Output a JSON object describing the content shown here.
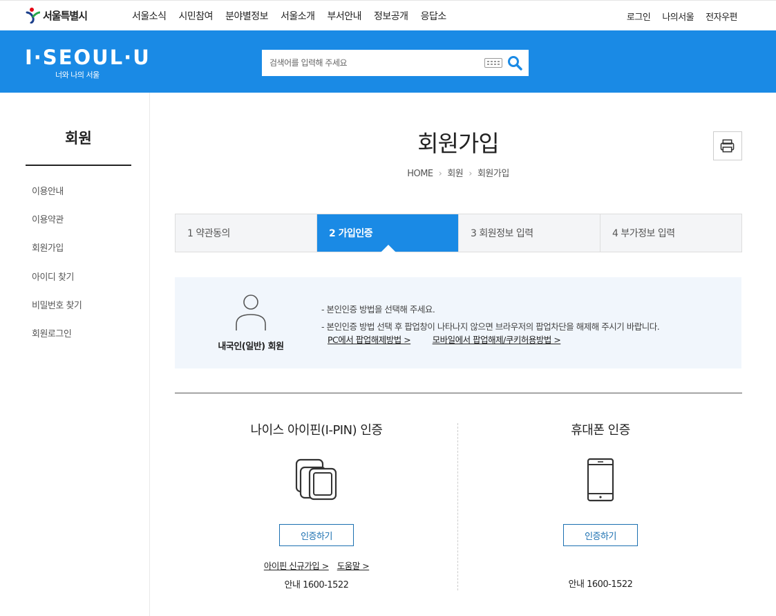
{
  "topbar": {
    "logo_text": "서울특별시",
    "gnb": [
      "서울소식",
      "시민참여",
      "분야별정보",
      "서울소개",
      "부서안내",
      "정보공개",
      "응답소"
    ],
    "util": [
      "로그인",
      "나의서울",
      "전자우편"
    ]
  },
  "header": {
    "brand": "I·SEOUL·U",
    "brand_sub": "너와 나의 서울",
    "search_placeholder": "검색어를 입력해 주세요"
  },
  "sidebar": {
    "title": "회원",
    "items": [
      "이용안내",
      "이용약관",
      "회원가입",
      "아이디 찾기",
      "비밀번호 찾기",
      "회원로그인"
    ]
  },
  "main": {
    "title": "회원가입",
    "breadcrumb": [
      "HOME",
      "회원",
      "회원가입"
    ],
    "steps": [
      "1 약관동의",
      "2 가입인증",
      "3 회원정보 입력",
      "4 부가정보 입력"
    ],
    "active_step": 1,
    "info": {
      "member_type": "내국인(일반) 회원",
      "notes": [
        "- 본인인증 방법을 선택해 주세요.",
        "- 본인인증 방법 선택 후 팝업창이 나타나지 않으면 브라우저의 팝업차단을 해제해 주시기 바랍니다."
      ],
      "link_pc": "PC에서 팝업해제방법 >",
      "link_mobile": "모바일에서 팝업해제/쿠키허용방법 >"
    },
    "ipin": {
      "title": "나이스 아이핀(I-PIN) 인증",
      "button": "인증하기",
      "link_signup": "아이핀 신규가입 >",
      "link_help": "도움말 >",
      "phone": "안내 1600-1522"
    },
    "mobile": {
      "title": "휴대폰 인증",
      "button": "인증하기",
      "phone": "안내 1600-1522"
    }
  },
  "colors": {
    "brand_blue": "#1a8ae5",
    "button_border": "#1a6fb0",
    "info_bg": "#f1f6fc"
  }
}
